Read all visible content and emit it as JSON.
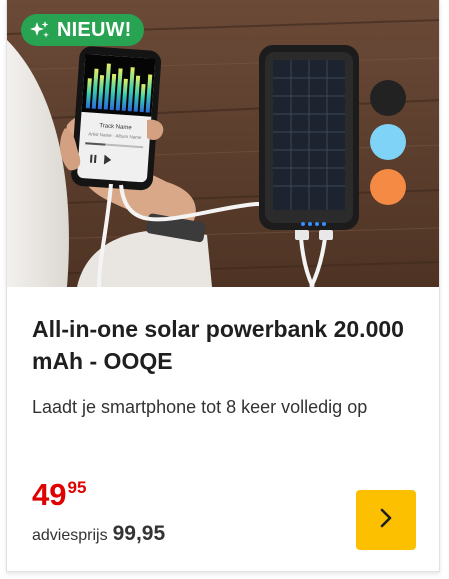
{
  "badge": {
    "label": "NIEUW!",
    "icon": "sparkle-icon",
    "color": "#27a352"
  },
  "product": {
    "title": "All-in-one solar powerbank 20.000 mAh - OOQE",
    "subtitle": "Laadt je smartphone tot 8 keer volledig op",
    "image_alt": "Solar powerbank charging a smartphone",
    "phone_screen": {
      "track": "Track Name",
      "artist": "Artist Name · Album Name"
    }
  },
  "color_options": [
    {
      "name": "black",
      "color": "#222222"
    },
    {
      "name": "light-blue",
      "color": "#7fd3f6"
    },
    {
      "name": "orange",
      "color": "#f58a45"
    }
  ],
  "price": {
    "whole": "49",
    "decimal": "95",
    "color": "#e00000",
    "advice_label": "adviesprijs",
    "advice_value": "99,95"
  },
  "cart_button": {
    "icon": "chevron-right-icon",
    "color": "#fcc000"
  }
}
